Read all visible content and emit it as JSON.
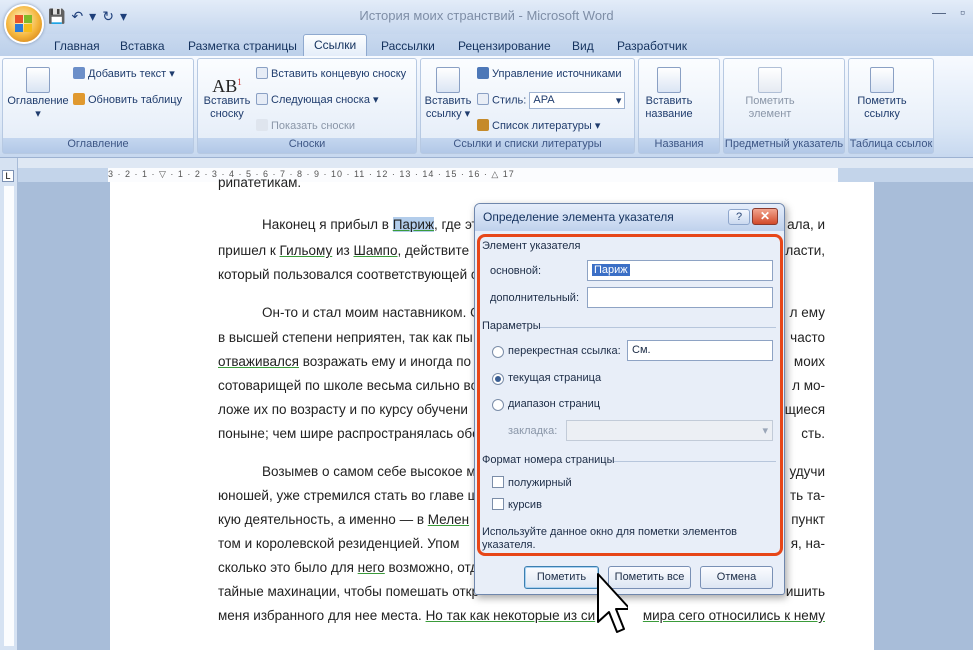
{
  "window": {
    "title": "История моих странствий - Microsoft Word"
  },
  "tabs": [
    "Главная",
    "Вставка",
    "Разметка страницы",
    "Ссылки",
    "Рассылки",
    "Рецензирование",
    "Вид",
    "Разработчик"
  ],
  "ribbon": {
    "toc": {
      "label": "Оглавление",
      "add_text": "Добавить текст",
      "update": "Обновить таблицу",
      "group": "Оглавление"
    },
    "footnotes": {
      "insert": "Вставить сноску",
      "ab": "AB",
      "endnote": "Вставить концевую сноску",
      "next": "Следующая сноска",
      "show": "Показать сноски",
      "group": "Сноски"
    },
    "citations": {
      "insert": "Вставить ссылку",
      "manage": "Управление источниками",
      "style_label": "Стиль:",
      "style_value": "APA",
      "bibliography": "Список литературы",
      "group": "Ссылки и списки литературы"
    },
    "captions": {
      "insert": "Вставить название",
      "group": "Названия"
    },
    "index": {
      "mark": "Пометить элемент",
      "group": "Предметный указатель"
    },
    "toa": {
      "mark": "Пометить ссылку",
      "group": "Таблица ссылок"
    }
  },
  "ruler": {
    "numbers": "3 · 2 · 1 · ▽ · 1 · 2 · 3 · 4 · 5 · 6 · 7 · 8 · 9 · 10 · 11 · 12 · 13 · 14 · 15 · 16 · △ 17"
  },
  "document": {
    "top_fragment": "рипатетикам.",
    "p1a": "Наконец я прибыл в ",
    "p1_paris": "Париж",
    "p1b": ", где эта",
    "p1c": "ала, и",
    "p2a": "пришел к ",
    "p2_guillaume": "Гильому",
    "p2b": " из ",
    "p2_champo": "Шампо",
    "p2c": ", действите",
    "p2d": "ласти,",
    "p3a": "который пользовался соответствующей с",
    "p4a": "Он-то и стал моим наставником. О",
    "p4b": "л ему",
    "p5a": "в высшей степени неприятен, так как пы",
    "p5b": "часто",
    "p6a": "отваживался",
    "p6b": " возражать ему и иногда по",
    "p6c": "моих",
    "p7a": "сотоварищей по школе весьма сильно воз",
    "p7b": "л мо-",
    "p8a": "ложе их по возрасту и по курсу обучени",
    "p8b": "щиеся",
    "p9a": "поныне; чем шире распространялась обо",
    "p9b": "сть.",
    "p10a": "Возымев о самом себе высокое м",
    "p10b": "удучи",
    "p11a": "юношей, уже стремился стать во главе ш",
    "p11b": "ть та-",
    "p12a": "кую деятельность, а именно — в ",
    "p12_melen": "Мелен",
    "p12b": "пункт",
    "p13a": "том и королевской резиденцией. Упом",
    "p13b": "я, на-",
    "p14a": "сколько это было для ",
    "p14_nego": "него",
    "p14b": " возможно, отд",
    "p14c": "ишить",
    "p15a": "тайные махинации, чтобы помешать откр",
    "p16a": "меня избранного для нее места. ",
    "p16b": "Но так как некоторые из си",
    "p16c": "мира сего относились к нему"
  },
  "dialog": {
    "title": "Определение элемента указателя",
    "help": "?",
    "close": "✕",
    "section_entry": "Элемент указателя",
    "main_label": "основной:",
    "main_value": "Париж",
    "sub_label": "дополнительный:",
    "sub_value": "",
    "section_options": "Параметры",
    "cross_ref": "перекрестная ссылка:",
    "cross_ref_value": "См.",
    "current_page": "текущая страница",
    "page_range": "диапазон страниц",
    "bookmark": "закладка:",
    "section_format": "Формат номера страницы",
    "bold": "полужирный",
    "italic": "курсив",
    "hint": "Используйте данное окно для пометки элементов указателя.",
    "mark": "Пометить",
    "mark_all": "Пометить все",
    "cancel": "Отмена"
  }
}
